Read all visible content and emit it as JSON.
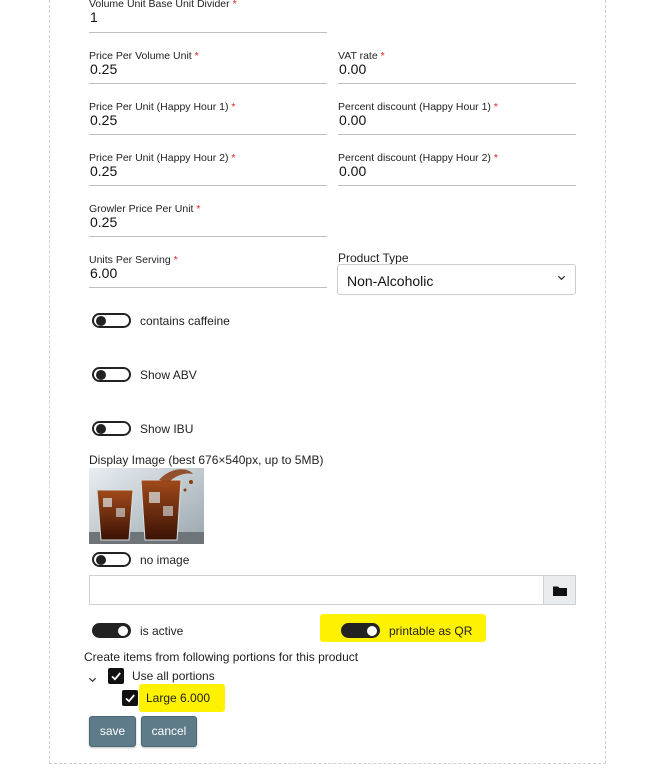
{
  "form": {
    "volume_divider": {
      "label": "Volume Unit Base Unit Divider",
      "value": "1"
    },
    "price_per_volume": {
      "label": "Price Per Volume Unit",
      "value": "0.25"
    },
    "vat_rate": {
      "label": "VAT rate",
      "value": "0.00"
    },
    "price_hh1": {
      "label": "Price Per Unit (Happy Hour 1)",
      "value": "0.25"
    },
    "discount_hh1": {
      "label": "Percent discount (Happy Hour 1)",
      "value": "0.00"
    },
    "price_hh2": {
      "label": "Price Per Unit (Happy Hour 2)",
      "value": "0.25"
    },
    "discount_hh2": {
      "label": "Percent discount (Happy Hour 2)",
      "value": "0.00"
    },
    "growler_price": {
      "label": "Growler Price Per Unit",
      "value": "0.25"
    },
    "units_per_serving": {
      "label": "Units Per Serving",
      "value": "6.00"
    },
    "product_type": {
      "label": "Product Type",
      "selected": "Non-Alcoholic"
    },
    "required_marker": "*"
  },
  "toggles": {
    "contains_caffeine": {
      "label": "contains caffeine",
      "on": false
    },
    "show_abv": {
      "label": "Show ABV",
      "on": false
    },
    "show_ibu": {
      "label": "Show IBU",
      "on": false
    },
    "no_image": {
      "label": "no image",
      "on": false
    },
    "is_active": {
      "label": "is active",
      "on": true
    },
    "printable_qr": {
      "label": "printable as QR",
      "on": true
    }
  },
  "image": {
    "label": "Display Image (best 676×540px, up to 5MB)",
    "file_value": ""
  },
  "portions": {
    "heading": "Create items from following portions for this product",
    "use_all": {
      "label": "Use all portions",
      "checked": true
    },
    "items": [
      {
        "label": "Large 6.000",
        "checked": true
      }
    ]
  },
  "buttons": {
    "save": "save",
    "cancel": "cancel"
  },
  "colors": {
    "highlight": "#fef200",
    "button": "#5d7b88",
    "required": "#e02020"
  },
  "icons": {
    "folder": "folder-icon",
    "select": "chevron-down-icon",
    "tree": "chevron-down-icon"
  }
}
